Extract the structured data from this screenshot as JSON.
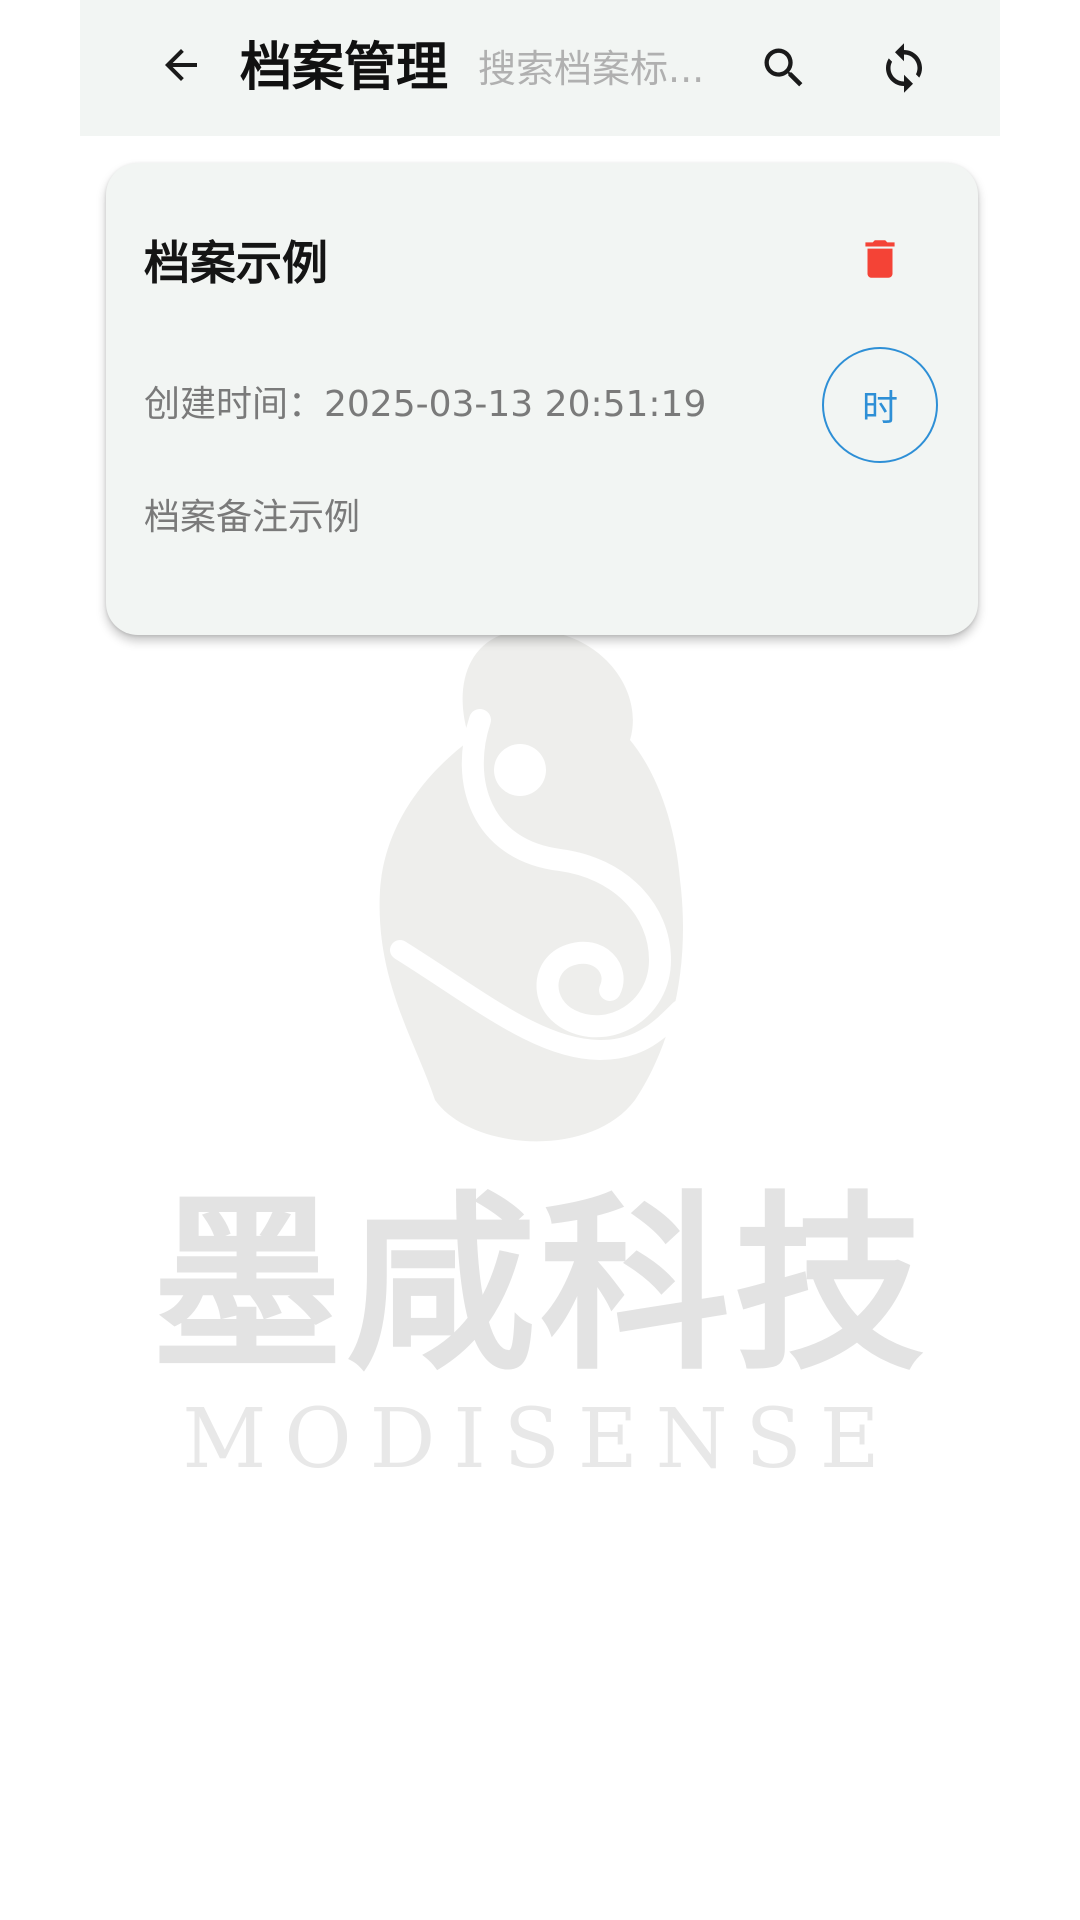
{
  "appbar": {
    "title": "档案管理",
    "search_placeholder": "搜索档案标...",
    "back_icon": "arrow-left-icon",
    "search_icon": "search-icon",
    "refresh_icon": "refresh-icon"
  },
  "records": [
    {
      "title": "档案示例",
      "created": "创建时间：2025-03-13 20:51:19",
      "note": "档案备注示例",
      "action_label": "时",
      "delete_icon": "trash-icon"
    }
  ],
  "watermark": {
    "brand_cn": "墨咸科技",
    "brand_en": "MODISENSE"
  },
  "colors": {
    "appbar_bg": "#f2f5f3",
    "card_bg": "#f2f5f3",
    "delete": "#f44336",
    "accent": "#2e8fd6",
    "watermark": "#e3e3e3"
  }
}
